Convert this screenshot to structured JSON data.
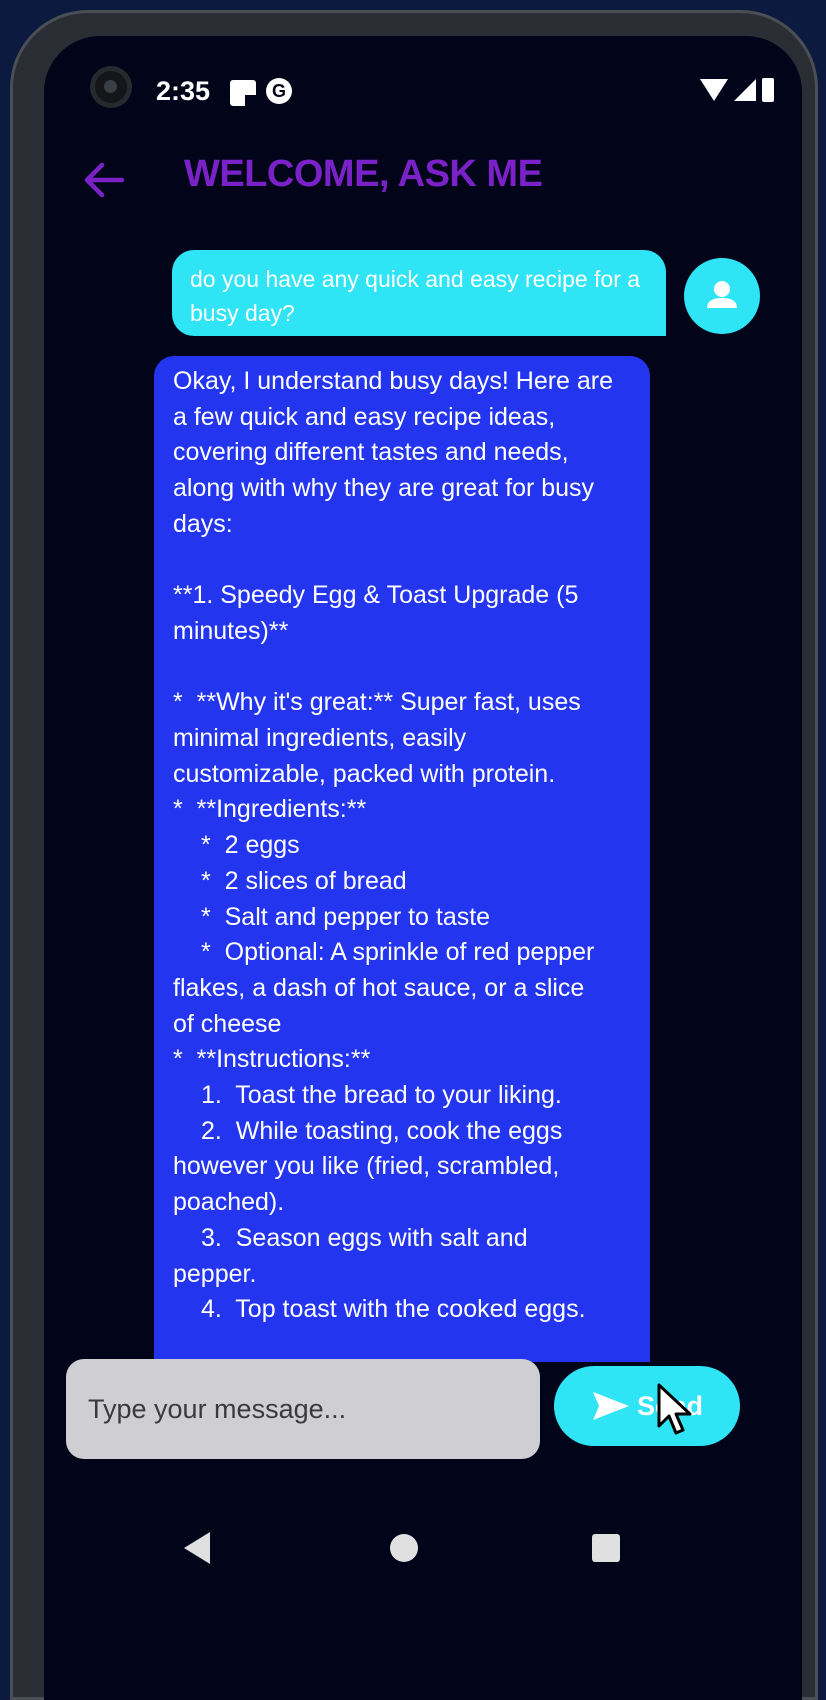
{
  "status_bar": {
    "time": "2:35",
    "g_icon": "G"
  },
  "header": {
    "title": "WELCOME, ASK ME"
  },
  "chat": {
    "user_message": "do you have any quick and easy recipe for a busy day?",
    "bot_message_lines": [
      "Okay, I understand busy days! Here are",
      "a few quick and easy recipe ideas,",
      "covering different tastes and needs,",
      "along with why they are great for busy",
      "days:",
      "",
      "**1. Speedy Egg & Toast Upgrade (5",
      "minutes)**",
      "",
      "*   **Why it's great:** Super fast, uses",
      "minimal ingredients, easily",
      "customizable, packed with protein.",
      "*   **Ingredients:**",
      "    *   2 eggs",
      "    *   2 slices of bread",
      "    *   Salt and pepper to taste",
      "    *   Optional: A sprinkle of red pepper",
      "flakes, a dash of hot sauce, or a slice",
      "of cheese",
      "*   **Instructions:**",
      "    1.  Toast the bread to your liking.",
      "    2.  While toasting, cook the eggs",
      "however you like (fried, scrambled,",
      "poached).",
      "    3.  Season eggs with salt and",
      "pepper.",
      "    4.  Top toast with the cooked eggs."
    ]
  },
  "composer": {
    "placeholder": "Type your message...",
    "send_label": "Send"
  },
  "icons": {
    "back": "arrow-left-icon",
    "avatar": "person-icon",
    "send": "send-icon",
    "nav": [
      "nav-back-icon",
      "nav-home-icon",
      "nav-recents-icon"
    ]
  },
  "colors": {
    "title": "#7a22c8",
    "accent_cyan": "#2ee4f5",
    "bot_bubble": "#2335ef",
    "background": "#02041a"
  }
}
